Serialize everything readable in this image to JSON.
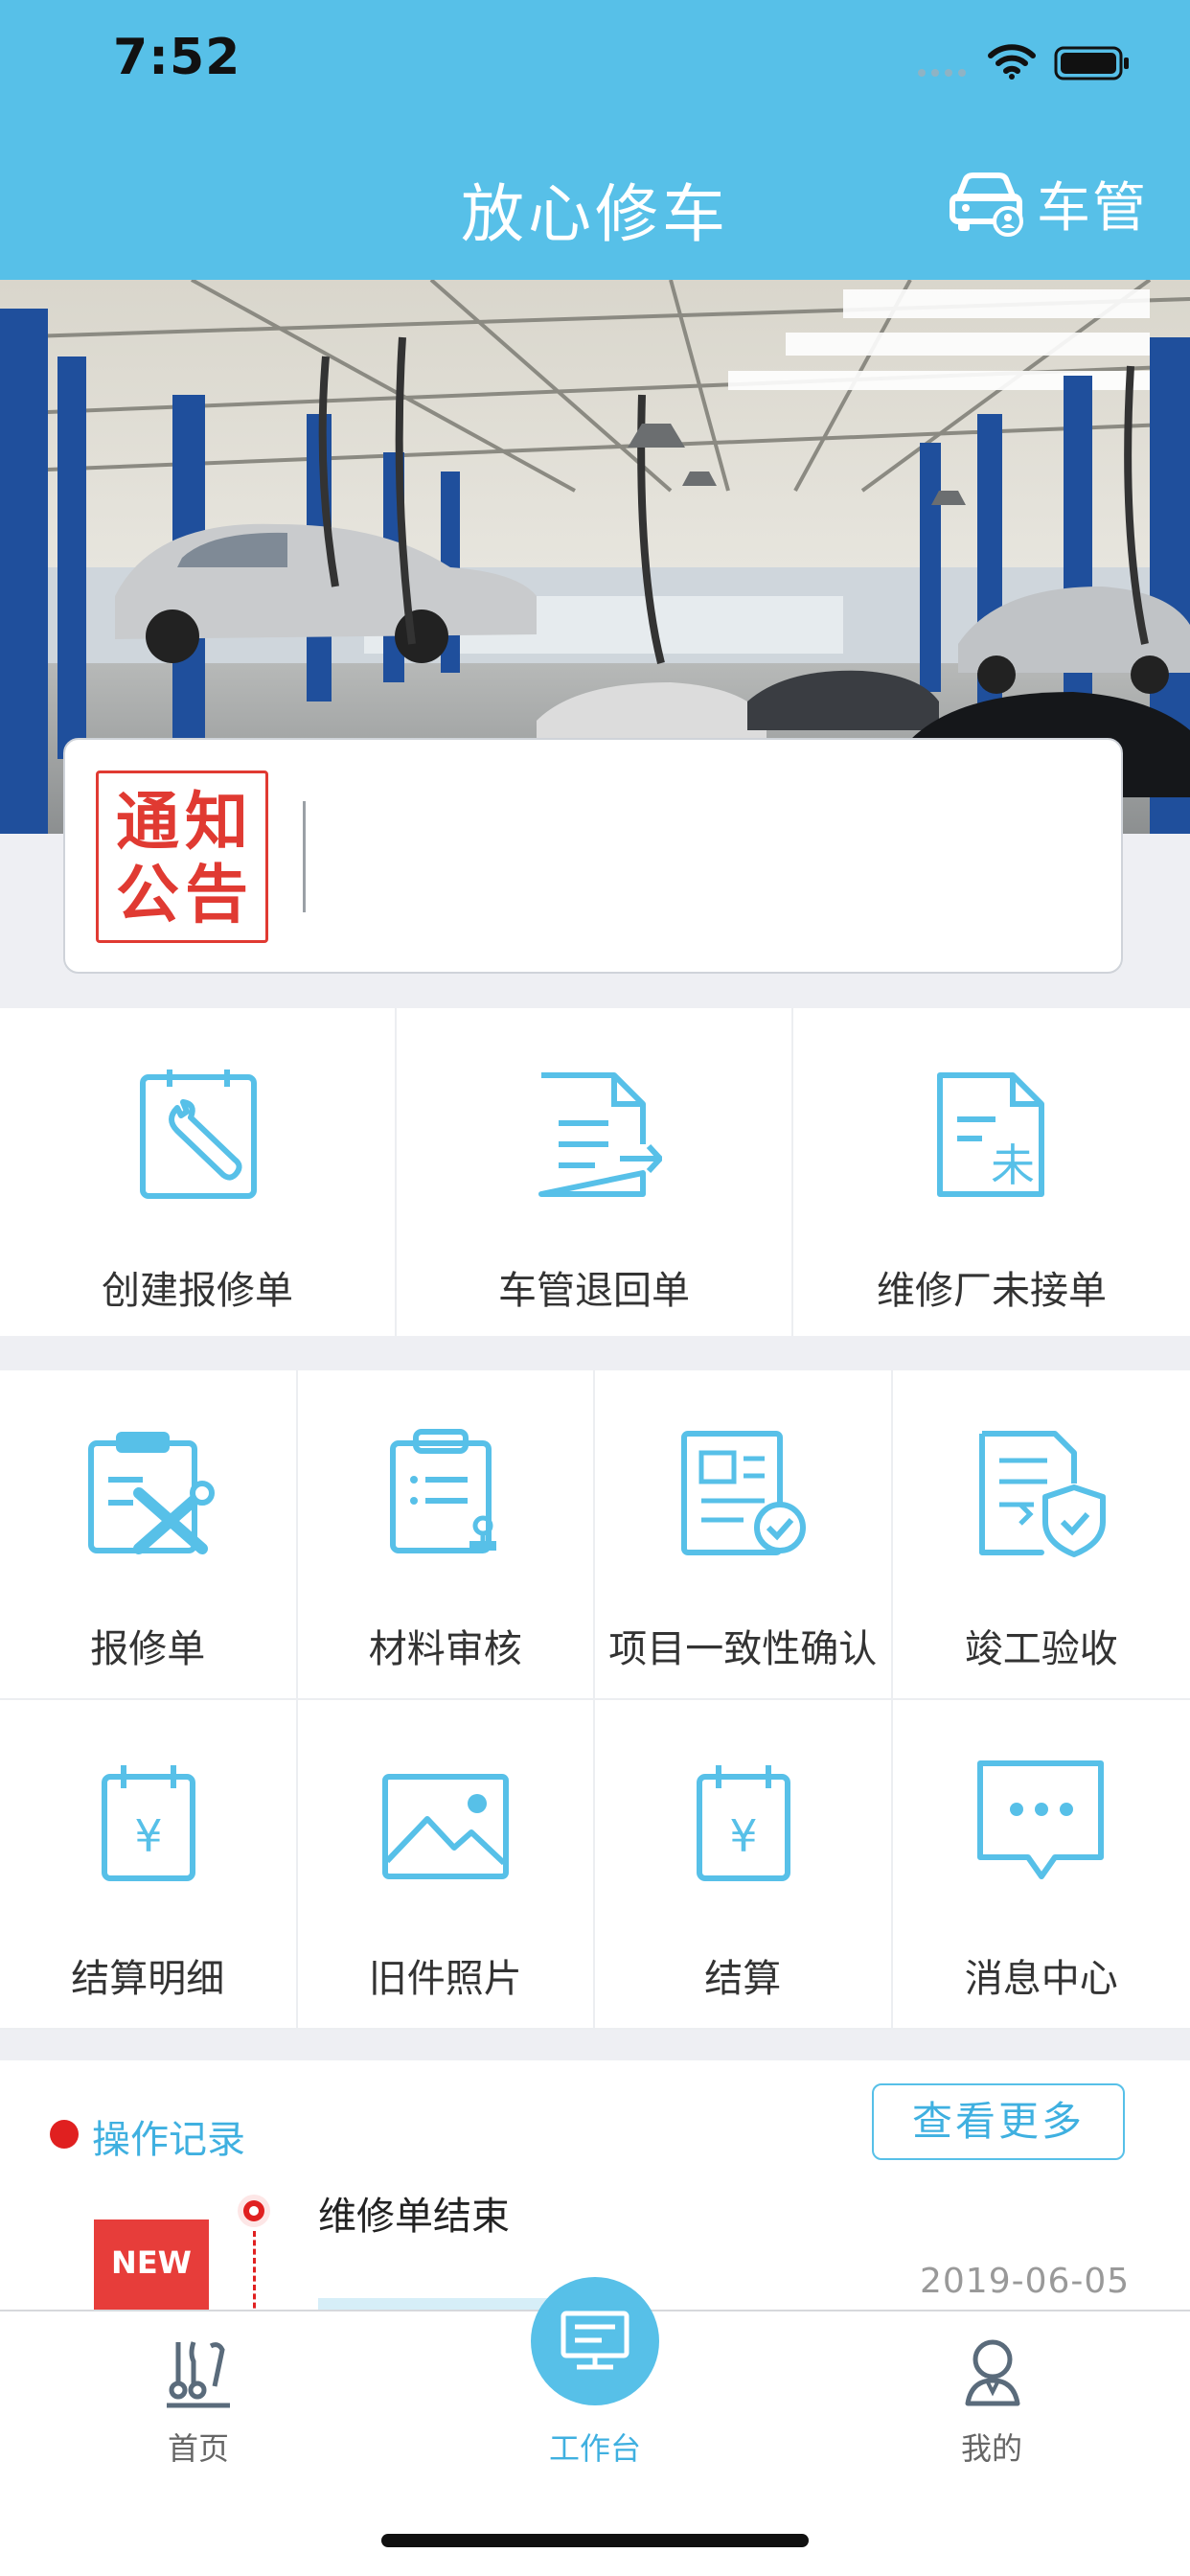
{
  "status_bar": {
    "time": "7:52"
  },
  "nav": {
    "title": "放心修车",
    "car_button_label": "车管"
  },
  "notice": {
    "stamp_chars": [
      "通",
      "知",
      "公",
      "告"
    ]
  },
  "grid_primary": [
    {
      "label": "创建报修单",
      "icon": "wrench-document-icon"
    },
    {
      "label": "车管退回单",
      "icon": "document-return-icon"
    },
    {
      "label": "维修厂未接单",
      "icon": "document-pending-icon"
    }
  ],
  "grid_secondary": [
    {
      "label": "报修单",
      "icon": "clipboard-tools-icon"
    },
    {
      "label": "材料审核",
      "icon": "clipboard-stamp-icon"
    },
    {
      "label": "项目一致性确认",
      "icon": "document-check-icon"
    },
    {
      "label": "竣工验收",
      "icon": "document-shield-icon"
    },
    {
      "label": "结算明细",
      "icon": "yen-calendar-icon"
    },
    {
      "label": "旧件照片",
      "icon": "image-icon"
    },
    {
      "label": "结算",
      "icon": "yen-calendar-icon"
    },
    {
      "label": "消息中心",
      "icon": "chat-bubble-icon"
    }
  ],
  "records": {
    "title": "操作记录",
    "more_label": "查看更多",
    "items": [
      {
        "badge": "NEW",
        "title": "维修单结束",
        "date": "2019-06-05"
      }
    ]
  },
  "tabbar": {
    "items": [
      {
        "label": "首页",
        "icon": "home-tools-icon",
        "active": false
      },
      {
        "label": "工作台",
        "icon": "workstation-icon",
        "active": true
      },
      {
        "label": "我的",
        "icon": "user-icon",
        "active": false
      }
    ]
  },
  "colors": {
    "primary": "#57c0e8",
    "accent_red": "#e02020",
    "text_active": "#3fb0e0",
    "text_inactive": "#666666"
  }
}
